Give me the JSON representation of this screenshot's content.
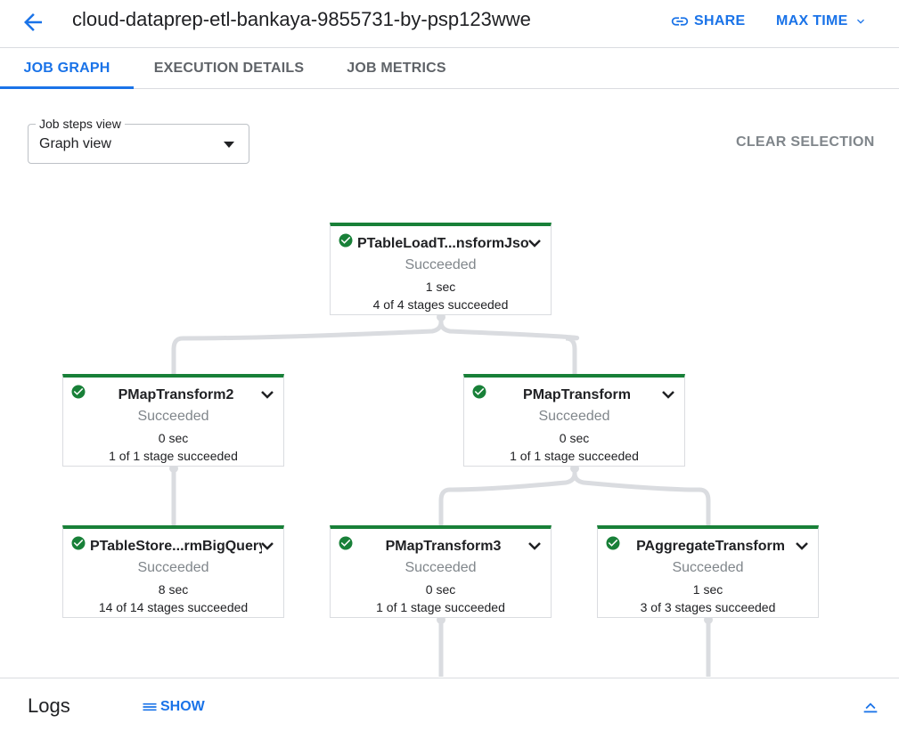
{
  "header": {
    "title": "cloud-dataprep-etl-bankaya-9855731-by-psp123wwe",
    "share_label": "SHARE",
    "time_label": "MAX TIME"
  },
  "tabs": [
    {
      "label": "JOB GRAPH",
      "active": true
    },
    {
      "label": "EXECUTION DETAILS",
      "active": false
    },
    {
      "label": "JOB METRICS",
      "active": false
    }
  ],
  "steps_view": {
    "label": "Job steps view",
    "value": "Graph view"
  },
  "clear_selection_label": "CLEAR SELECTION",
  "nodes": [
    {
      "name": "PTableLoadT...nsformJson",
      "status": "Succeeded",
      "time": "1 sec",
      "stages": "4 of 4 stages succeeded"
    },
    {
      "name": "PMapTransform2",
      "status": "Succeeded",
      "time": "0 sec",
      "stages": "1 of 1 stage succeeded"
    },
    {
      "name": "PMapTransform",
      "status": "Succeeded",
      "time": "0 sec",
      "stages": "1 of 1 stage succeeded"
    },
    {
      "name": "PTableStore...rmBigQuery",
      "status": "Succeeded",
      "time": "8 sec",
      "stages": "14 of 14 stages succeeded"
    },
    {
      "name": "PMapTransform3",
      "status": "Succeeded",
      "time": "0 sec",
      "stages": "1 of 1 stage succeeded"
    },
    {
      "name": "PAggregateTransform",
      "status": "Succeeded",
      "time": "1 sec",
      "stages": "3 of 3 stages succeeded"
    }
  ],
  "logs": {
    "title": "Logs",
    "show_label": "SHOW"
  },
  "colors": {
    "accent": "#1a73e8",
    "success": "#188038",
    "edge": "#dadce0"
  },
  "icons": [
    "back-arrow-icon",
    "link-icon",
    "chevron-down-icon",
    "check-circle-icon",
    "list-icon",
    "expand-less-icon"
  ]
}
